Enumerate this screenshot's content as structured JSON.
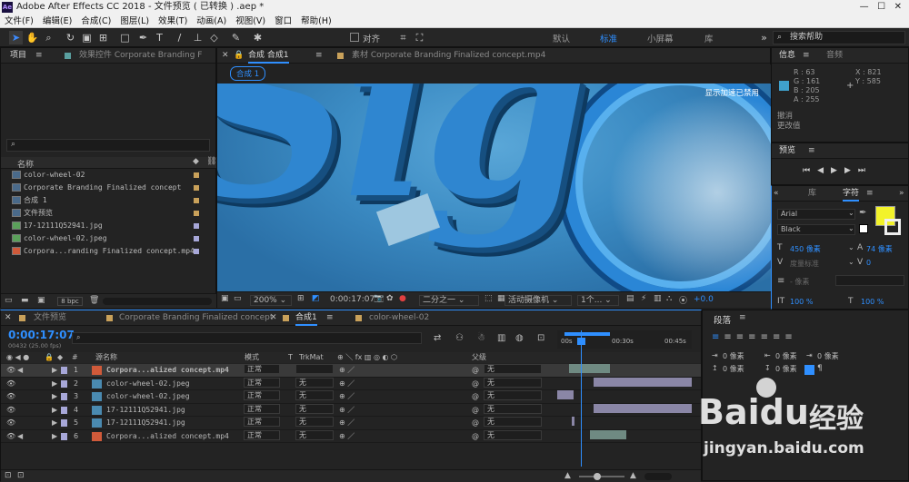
{
  "window": {
    "title": "Adobe After Effects CC 2018 - 文件预览 ( 已转换 ) .aep *",
    "logo_text": "Ae"
  },
  "menu": [
    "文件(F)",
    "编辑(E)",
    "合成(C)",
    "图层(L)",
    "效果(T)",
    "动画(A)",
    "视图(V)",
    "窗口",
    "帮助(H)"
  ],
  "toolbar": {
    "snap_label": "对齐",
    "workspaces": [
      "默认",
      "标准",
      "小屏幕",
      "库"
    ],
    "active_workspace": "标准",
    "search_placeholder": "搜索帮助"
  },
  "project_panel": {
    "tab_project": "项目",
    "tab_effects": "效果控件 Corporate Branding F",
    "search_icon": "search-icon",
    "col_name": "名称",
    "items": [
      {
        "name": "color-wheel-02",
        "icon": "composition-icon",
        "tag_color": "#c9a15a"
      },
      {
        "name": "Corporate Branding  Finalized concept",
        "icon": "composition-icon",
        "tag_color": "#c9a15a"
      },
      {
        "name": "合成 1",
        "icon": "composition-icon",
        "tag_color": "#c9a15a"
      },
      {
        "name": "文件预览",
        "icon": "composition-icon",
        "tag_color": "#c9a15a"
      },
      {
        "name": "17-12111Q52941.jpg",
        "icon": "image-icon",
        "tag_color": "#a7a7d8"
      },
      {
        "name": "color-wheel-02.jpeg",
        "icon": "image-icon",
        "tag_color": "#a7a7d8"
      },
      {
        "name": "Corpora...randing  Finalized concept.mp4",
        "icon": "video-icon",
        "tag_color": "#a7a7d8"
      }
    ],
    "bpc": "8 bpc"
  },
  "viewer": {
    "tab_comp": "合成 合成1",
    "tab_footage": "素材 Corporate Branding  Finalized concept.mp4",
    "breadcrumb": "合成 1",
    "overlay_text": "显示加速已禁用",
    "zoom": "200%",
    "timecode": "0:00:17:07",
    "resolution": "二分之一",
    "camera": "活动摄像机",
    "views": "1个...",
    "exposure": "+0.0"
  },
  "info_panel": {
    "tab_info": "信息",
    "tab_audio": "音频",
    "r": "R : 63",
    "g": "G : 161",
    "b": "B : 205",
    "a": "A : 255",
    "x": "X : 821",
    "y": "Y : 585",
    "swatch_color": "#3fa1cd",
    "undo": "撤消",
    "change_value": "更改值"
  },
  "preview_panel": {
    "title": "预览"
  },
  "char_panel": {
    "tab_lib": "库",
    "tab_char": "字符",
    "font": "Arial",
    "style": "Black",
    "size": "450 像素",
    "leading": "74 像素",
    "kerning": "度量标准",
    "tracking": "0",
    "stroke": "- 像素",
    "fill_color": "#f2f22a",
    "scale_v": "100 %",
    "scale_h": "100 %"
  },
  "timeline": {
    "tabs": [
      "文件预览",
      "Corporate Branding  Finalized concept",
      "合成1",
      "color-wheel-02"
    ],
    "active_tab": "合成1",
    "tab_colors": [
      "#c9a15a",
      "#c9a15a",
      "#c9a15a",
      "#c9a15a"
    ],
    "timecode": "0:00:17:07",
    "frames": "00432 (25.00 fps)",
    "cols": {
      "num": "#",
      "name": "源名称",
      "mode": "模式",
      "t": "T",
      "trkmat": "TrkMat",
      "parent": "父级"
    },
    "ruler": [
      "00s",
      "00:30s",
      "00:45s"
    ],
    "layers": [
      {
        "num": "1",
        "name": "Corpora...alized concept.mp4",
        "mode": "正常",
        "trkmat": "",
        "parent": "无",
        "label": "#a7a7d8",
        "icon": "video-icon",
        "bar_color": "#6f8a82",
        "selected": true
      },
      {
        "num": "2",
        "name": "color-wheel-02.jpeg",
        "mode": "正常",
        "trkmat": "无",
        "parent": "无",
        "label": "#a7a7d8",
        "icon": "image-icon",
        "bar_color": "#8a86a6"
      },
      {
        "num": "3",
        "name": "color-wheel-02.jpeg",
        "mode": "正常",
        "trkmat": "无",
        "parent": "无",
        "label": "#a7a7d8",
        "icon": "image-icon",
        "bar_color": "#8a86a6"
      },
      {
        "num": "4",
        "name": "17-12111Q52941.jpg",
        "mode": "正常",
        "trkmat": "无",
        "parent": "无",
        "label": "#a7a7d8",
        "icon": "image-icon",
        "bar_color": "#8a86a6"
      },
      {
        "num": "5",
        "name": "17-12111Q52941.jpg",
        "mode": "正常",
        "trkmat": "无",
        "parent": "无",
        "label": "#a7a7d8",
        "icon": "image-icon",
        "bar_color": "#8a86a6"
      },
      {
        "num": "6",
        "name": "Corpora...alized concept.mp4",
        "mode": "正常",
        "trkmat": "无",
        "parent": "无",
        "label": "#a7a7d8",
        "icon": "video-icon",
        "bar_color": "#6f8a82"
      }
    ]
  },
  "paragraph_panel": {
    "title": "段落",
    "indent_left": "0 像素",
    "indent_right": "0 像素",
    "indent_first": "0 像素",
    "space_before": "0 像素",
    "space_after": "0 像素"
  },
  "watermark": {
    "brand": "Baidu",
    "brand_cn": "经验",
    "url": "jingyan.baidu.com"
  }
}
